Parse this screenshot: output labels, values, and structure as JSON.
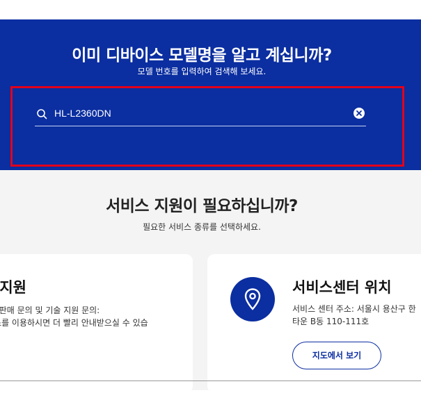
{
  "hero": {
    "title": "이미 디바이스 모델명을 알고 계십니까?",
    "subtitle": "모델 번호를 입력하여 검색해 보세요.",
    "search_value": "HL-L2360DN"
  },
  "service": {
    "title": "서비스 지원이 필요하십니까?",
    "subtitle": "필요한 서비스 종류를 선택하세요.",
    "cards": [
      {
        "heading": "택지원",
        "line1": "원, 판매 문의 및 기술 지원 문의:",
        "line2": "비스를 이용하시면 더 빨리 안내받으실 수 있습"
      },
      {
        "heading": "서비스센터 위치",
        "line1": "서비스 센터 주소: 서울시 용산구 한",
        "line2": "타운 B동 110-111호",
        "button": "지도에서 보기",
        "icon": "location-pin-icon"
      }
    ]
  },
  "colors": {
    "brand": "#0b2ea0",
    "highlight": "#e3001b",
    "background": "#f4f4f4"
  }
}
